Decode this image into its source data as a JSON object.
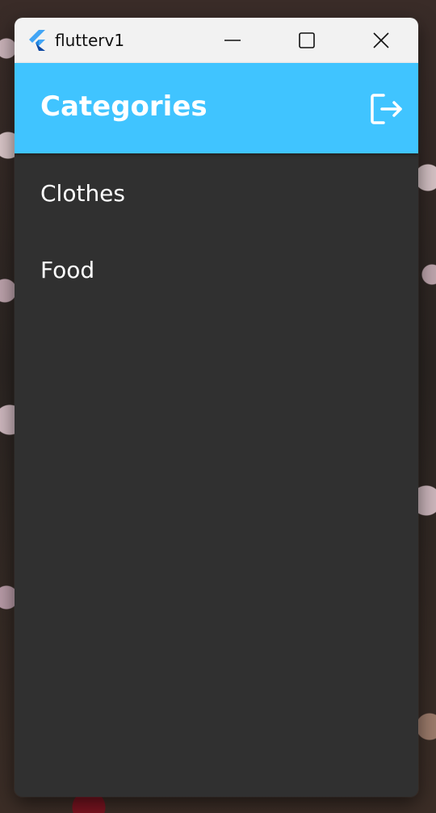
{
  "window": {
    "title": "flutterv1",
    "app_icon": "flutter-logo-icon",
    "caption_icons": [
      "minimize-icon",
      "maximize-icon",
      "close-icon"
    ]
  },
  "appbar": {
    "title": "Categories",
    "action_icon": "logout-icon",
    "color": "#40c4ff"
  },
  "categories": [
    {
      "label": "Clothes"
    },
    {
      "label": "Food"
    }
  ],
  "colors": {
    "body_background": "#303030",
    "titlebar_background": "#f2f2f2",
    "text": "#ffffff"
  }
}
